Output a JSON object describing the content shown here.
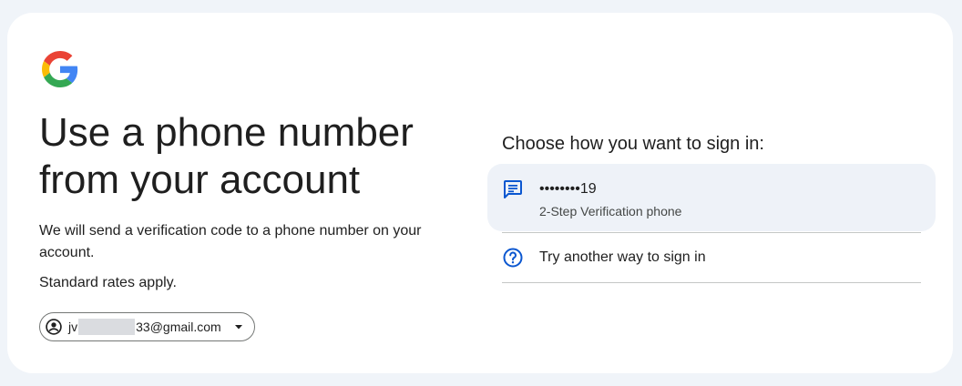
{
  "headline": {
    "line1": "Use a phone number",
    "line2": "from your account"
  },
  "description": "We will send a verification code to a phone number on your account.",
  "rates_note": "Standard rates apply.",
  "account": {
    "email_prefix": "jv",
    "email_suffix": "33@gmail.com"
  },
  "choose_title": "Choose how you want to sign in:",
  "options": [
    {
      "icon": "message-icon",
      "label": "••••••••19",
      "sublabel": "2-Step Verification phone"
    },
    {
      "icon": "help-circle-icon",
      "label": "Try another way to sign in"
    }
  ],
  "colors": {
    "accent": "#0b57d0",
    "page_bg": "#f0f4f9",
    "option_bg": "#eef2f8",
    "divider": "#c4c7c5",
    "google_blue": "#4285F4",
    "google_red": "#EA4335",
    "google_yellow": "#FBBC05",
    "google_green": "#34A853"
  }
}
